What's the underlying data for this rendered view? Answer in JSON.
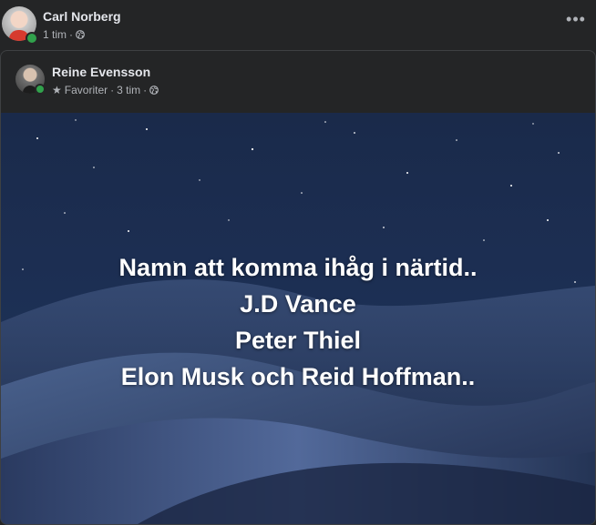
{
  "post": {
    "author": "Carl Norberg",
    "time": "1 tim",
    "separator": "·",
    "more": "•••"
  },
  "shared_post": {
    "author": "Reine Evensson",
    "favorites": "Favoriter",
    "separator": "·",
    "time": "3 tim"
  },
  "image_text": {
    "lines": [
      "Namn att komma ihåg i närtid..",
      "J.D Vance",
      "Peter Thiel",
      "Elon Musk och Reid Hoffman.."
    ]
  },
  "colors": {
    "background": "#242526",
    "online": "#31a24c",
    "secondary_text": "#b0b3b8"
  },
  "icons": [
    "globe-icon",
    "star-icon",
    "more-icon"
  ]
}
